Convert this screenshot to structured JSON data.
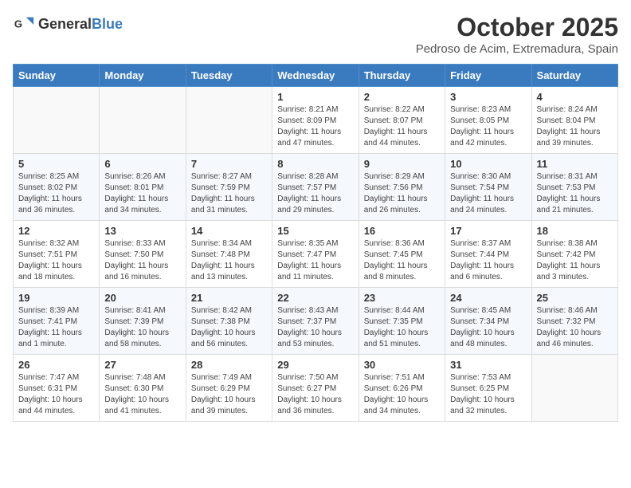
{
  "logo": {
    "text_general": "General",
    "text_blue": "Blue"
  },
  "header": {
    "month": "October 2025",
    "location": "Pedroso de Acim, Extremadura, Spain"
  },
  "weekdays": [
    "Sunday",
    "Monday",
    "Tuesday",
    "Wednesday",
    "Thursday",
    "Friday",
    "Saturday"
  ],
  "weeks": [
    [
      {
        "day": "",
        "info": ""
      },
      {
        "day": "",
        "info": ""
      },
      {
        "day": "",
        "info": ""
      },
      {
        "day": "1",
        "info": "Sunrise: 8:21 AM\nSunset: 8:09 PM\nDaylight: 11 hours and 47 minutes."
      },
      {
        "day": "2",
        "info": "Sunrise: 8:22 AM\nSunset: 8:07 PM\nDaylight: 11 hours and 44 minutes."
      },
      {
        "day": "3",
        "info": "Sunrise: 8:23 AM\nSunset: 8:05 PM\nDaylight: 11 hours and 42 minutes."
      },
      {
        "day": "4",
        "info": "Sunrise: 8:24 AM\nSunset: 8:04 PM\nDaylight: 11 hours and 39 minutes."
      }
    ],
    [
      {
        "day": "5",
        "info": "Sunrise: 8:25 AM\nSunset: 8:02 PM\nDaylight: 11 hours and 36 minutes."
      },
      {
        "day": "6",
        "info": "Sunrise: 8:26 AM\nSunset: 8:01 PM\nDaylight: 11 hours and 34 minutes."
      },
      {
        "day": "7",
        "info": "Sunrise: 8:27 AM\nSunset: 7:59 PM\nDaylight: 11 hours and 31 minutes."
      },
      {
        "day": "8",
        "info": "Sunrise: 8:28 AM\nSunset: 7:57 PM\nDaylight: 11 hours and 29 minutes."
      },
      {
        "day": "9",
        "info": "Sunrise: 8:29 AM\nSunset: 7:56 PM\nDaylight: 11 hours and 26 minutes."
      },
      {
        "day": "10",
        "info": "Sunrise: 8:30 AM\nSunset: 7:54 PM\nDaylight: 11 hours and 24 minutes."
      },
      {
        "day": "11",
        "info": "Sunrise: 8:31 AM\nSunset: 7:53 PM\nDaylight: 11 hours and 21 minutes."
      }
    ],
    [
      {
        "day": "12",
        "info": "Sunrise: 8:32 AM\nSunset: 7:51 PM\nDaylight: 11 hours and 18 minutes."
      },
      {
        "day": "13",
        "info": "Sunrise: 8:33 AM\nSunset: 7:50 PM\nDaylight: 11 hours and 16 minutes."
      },
      {
        "day": "14",
        "info": "Sunrise: 8:34 AM\nSunset: 7:48 PM\nDaylight: 11 hours and 13 minutes."
      },
      {
        "day": "15",
        "info": "Sunrise: 8:35 AM\nSunset: 7:47 PM\nDaylight: 11 hours and 11 minutes."
      },
      {
        "day": "16",
        "info": "Sunrise: 8:36 AM\nSunset: 7:45 PM\nDaylight: 11 hours and 8 minutes."
      },
      {
        "day": "17",
        "info": "Sunrise: 8:37 AM\nSunset: 7:44 PM\nDaylight: 11 hours and 6 minutes."
      },
      {
        "day": "18",
        "info": "Sunrise: 8:38 AM\nSunset: 7:42 PM\nDaylight: 11 hours and 3 minutes."
      }
    ],
    [
      {
        "day": "19",
        "info": "Sunrise: 8:39 AM\nSunset: 7:41 PM\nDaylight: 11 hours and 1 minute."
      },
      {
        "day": "20",
        "info": "Sunrise: 8:41 AM\nSunset: 7:39 PM\nDaylight: 10 hours and 58 minutes."
      },
      {
        "day": "21",
        "info": "Sunrise: 8:42 AM\nSunset: 7:38 PM\nDaylight: 10 hours and 56 minutes."
      },
      {
        "day": "22",
        "info": "Sunrise: 8:43 AM\nSunset: 7:37 PM\nDaylight: 10 hours and 53 minutes."
      },
      {
        "day": "23",
        "info": "Sunrise: 8:44 AM\nSunset: 7:35 PM\nDaylight: 10 hours and 51 minutes."
      },
      {
        "day": "24",
        "info": "Sunrise: 8:45 AM\nSunset: 7:34 PM\nDaylight: 10 hours and 48 minutes."
      },
      {
        "day": "25",
        "info": "Sunrise: 8:46 AM\nSunset: 7:32 PM\nDaylight: 10 hours and 46 minutes."
      }
    ],
    [
      {
        "day": "26",
        "info": "Sunrise: 7:47 AM\nSunset: 6:31 PM\nDaylight: 10 hours and 44 minutes."
      },
      {
        "day": "27",
        "info": "Sunrise: 7:48 AM\nSunset: 6:30 PM\nDaylight: 10 hours and 41 minutes."
      },
      {
        "day": "28",
        "info": "Sunrise: 7:49 AM\nSunset: 6:29 PM\nDaylight: 10 hours and 39 minutes."
      },
      {
        "day": "29",
        "info": "Sunrise: 7:50 AM\nSunset: 6:27 PM\nDaylight: 10 hours and 36 minutes."
      },
      {
        "day": "30",
        "info": "Sunrise: 7:51 AM\nSunset: 6:26 PM\nDaylight: 10 hours and 34 minutes."
      },
      {
        "day": "31",
        "info": "Sunrise: 7:53 AM\nSunset: 6:25 PM\nDaylight: 10 hours and 32 minutes."
      },
      {
        "day": "",
        "info": ""
      }
    ]
  ]
}
